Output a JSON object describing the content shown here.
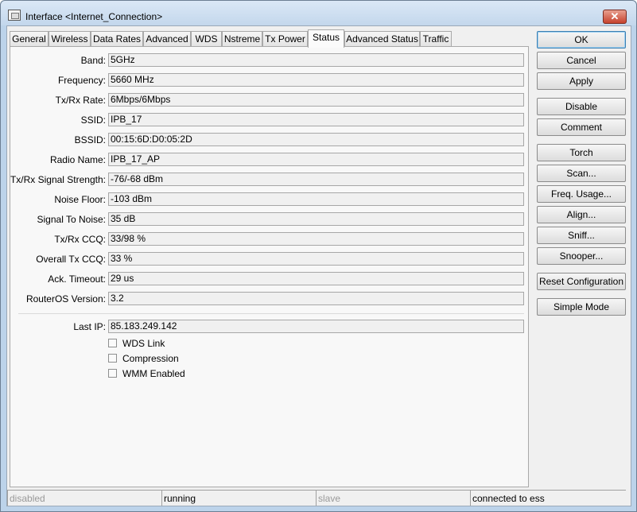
{
  "window": {
    "title": "Interface <Internet_Connection>",
    "close_label": "✕",
    "icon": "window-icon"
  },
  "tabs": [
    {
      "label": "General",
      "active": false
    },
    {
      "label": "Wireless",
      "active": false
    },
    {
      "label": "Data Rates",
      "active": false
    },
    {
      "label": "Advanced",
      "active": false
    },
    {
      "label": "WDS",
      "active": false
    },
    {
      "label": "Nstreme",
      "active": false
    },
    {
      "label": "Tx Power",
      "active": false
    },
    {
      "label": "Status",
      "active": true
    },
    {
      "label": "Advanced Status",
      "active": false
    },
    {
      "label": "Traffic",
      "active": false
    }
  ],
  "status": {
    "fields": [
      {
        "label": "Band:",
        "value": "5GHz"
      },
      {
        "label": "Frequency:",
        "value": "5660 MHz"
      },
      {
        "label": "Tx/Rx Rate:",
        "value": "6Mbps/6Mbps"
      },
      {
        "label": "SSID:",
        "value": "IPB_17"
      },
      {
        "label": "BSSID:",
        "value": "00:15:6D:D0:05:2D"
      },
      {
        "label": "Radio Name:",
        "value": "IPB_17_AP"
      },
      {
        "label": "Tx/Rx Signal Strength:",
        "value": "-76/-68 dBm"
      },
      {
        "label": "Noise Floor:",
        "value": "-103 dBm"
      },
      {
        "label": "Signal To Noise:",
        "value": "35 dB"
      },
      {
        "label": "Tx/Rx CCQ:",
        "value": "33/98 %"
      },
      {
        "label": "Overall Tx CCQ:",
        "value": "33 %"
      },
      {
        "label": "Ack. Timeout:",
        "value": "29 us"
      },
      {
        "label": "RouterOS Version:",
        "value": "3.2"
      }
    ],
    "last_ip": {
      "label": "Last IP:",
      "value": "85.183.249.142"
    },
    "checkboxes": [
      {
        "label": "WDS Link",
        "checked": false
      },
      {
        "label": "Compression",
        "checked": false
      },
      {
        "label": "WMM Enabled",
        "checked": false
      }
    ]
  },
  "buttons": [
    "OK",
    "Cancel",
    "Apply",
    "Disable",
    "Comment",
    "Torch",
    "Scan...",
    "Freq. Usage...",
    "Align...",
    "Sniff...",
    "Snooper...",
    "Reset Configuration",
    "Simple Mode"
  ],
  "statusbar": [
    "disabled",
    "running",
    "slave",
    "connected to ess"
  ]
}
